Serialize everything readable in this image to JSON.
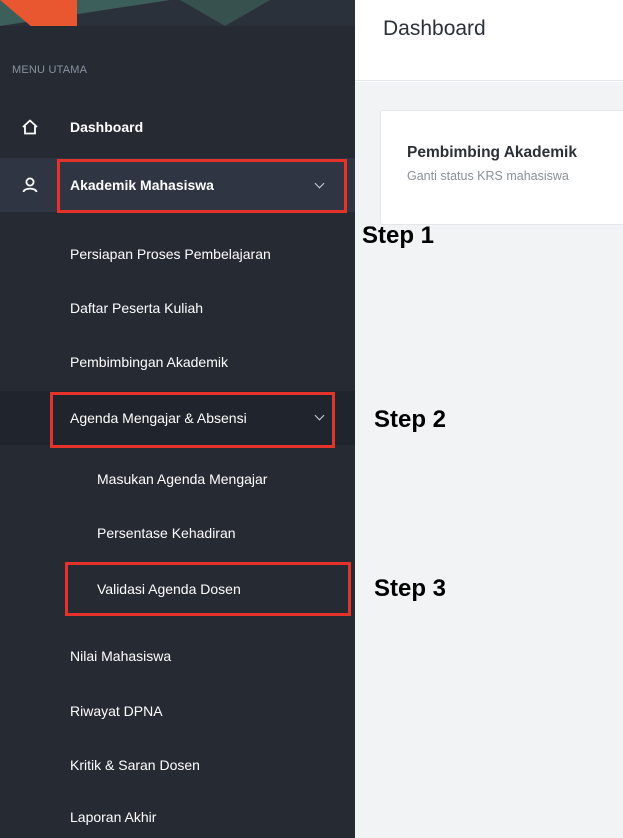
{
  "sidebar": {
    "heading": "MENU UTAMA",
    "dashboard": {
      "label": "Dashboard",
      "icon": "home-icon"
    },
    "akademik": {
      "label": "Akademik Mahasiswa",
      "icon": "user-icon"
    },
    "items": [
      "Persiapan Proses Pembelajaran",
      "Daftar Peserta Kuliah",
      "Pembimbingan Akademik",
      "Agenda Mengajar & Absensi",
      "Masukan Agenda Mengajar",
      "Persentase Kehadiran",
      "Validasi Agenda Dosen",
      "Nilai Mahasiswa",
      "Riwayat DPNA",
      "Kritik & Saran Dosen",
      "Laporan Akhir"
    ]
  },
  "header": {
    "title": "Dashboard"
  },
  "card": {
    "title": "Pembimbing Akademik",
    "subtitle": "Ganti status KRS mahasiswa"
  },
  "steps": [
    "Step 1",
    "Step 2",
    "Step 3"
  ],
  "colors": {
    "sidebar_bg": "#252a33",
    "highlight_red": "#e5322b",
    "accent_orange": "#e8572f"
  }
}
